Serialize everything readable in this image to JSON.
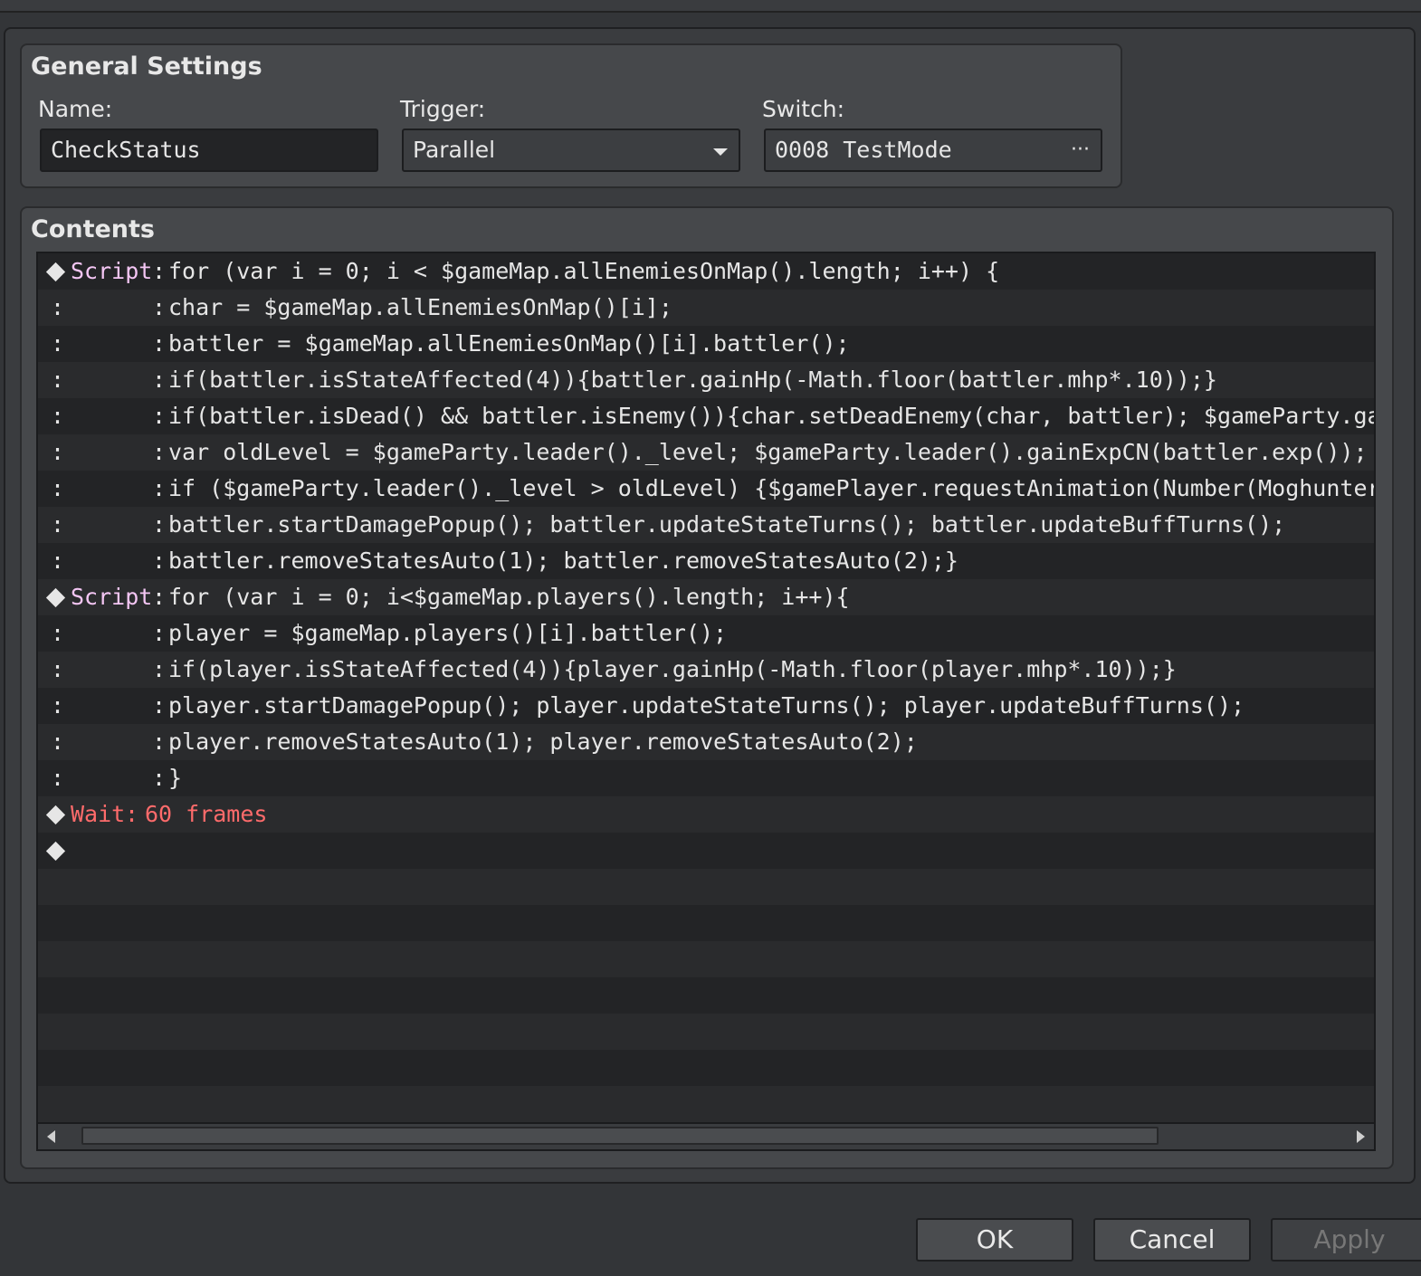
{
  "general": {
    "title": "General Settings",
    "name_label": "Name:",
    "name_value": "CheckStatus",
    "trigger_label": "Trigger:",
    "trigger_value": "Parallel",
    "switch_label": "Switch:",
    "switch_value": "0008 TestMode",
    "switch_button": "···"
  },
  "contents": {
    "title": "Contents",
    "rows": [
      {
        "kind": "script",
        "cmd": "Script",
        "code": "for (var i = 0; i < $gameMap.allEnemiesOnMap().length; i++) {"
      },
      {
        "kind": "cont",
        "code": "char = $gameMap.allEnemiesOnMap()[i];"
      },
      {
        "kind": "cont",
        "code": "battler = $gameMap.allEnemiesOnMap()[i].battler();"
      },
      {
        "kind": "cont",
        "code": " if(battler.isStateAffected(4)){battler.gainHp(-Math.floor(battler.mhp*.10));}"
      },
      {
        "kind": "cont",
        "code": "if(battler.isDead() && battler.isEnemy()){char.setDeadEnemy(char, battler); $gameParty.gainGold(ba"
      },
      {
        "kind": "cont",
        "code": "var oldLevel = $gameParty.leader()._level; $gameParty.leader().gainExpCN(battler.exp());"
      },
      {
        "kind": "cont",
        "code": "if ($gameParty.leader()._level > oldLevel) {$gamePlayer.requestAnimation(Number(Moghunter.ras_leve"
      },
      {
        "kind": "cont",
        "code": "battler.startDamagePopup(); battler.updateStateTurns(); battler.updateBuffTurns();"
      },
      {
        "kind": "cont",
        "code": "battler.removeStatesAuto(1); battler.removeStatesAuto(2);}"
      },
      {
        "kind": "script",
        "cmd": "Script",
        "code": "for (var i = 0; i<$gameMap.players().length; i++){"
      },
      {
        "kind": "cont",
        "code": "player = $gameMap.players()[i].battler();"
      },
      {
        "kind": "cont",
        "code": "if(player.isStateAffected(4)){player.gainHp(-Math.floor(player.mhp*.10));}"
      },
      {
        "kind": "cont",
        "code": "player.startDamagePopup(); player.updateStateTurns(); player.updateBuffTurns();"
      },
      {
        "kind": "cont",
        "code": "player.removeStatesAuto(1); player.removeStatesAuto(2);"
      },
      {
        "kind": "cont",
        "code": "}"
      },
      {
        "kind": "wait",
        "cmd": "Wait",
        "code": "60 frames"
      },
      {
        "kind": "end"
      }
    ]
  },
  "buttons": {
    "ok": "OK",
    "cancel": "Cancel",
    "apply": "Apply"
  },
  "colors": {
    "script_cmd": "#f4c6f4",
    "wait_cmd": "#ff6b6b"
  }
}
